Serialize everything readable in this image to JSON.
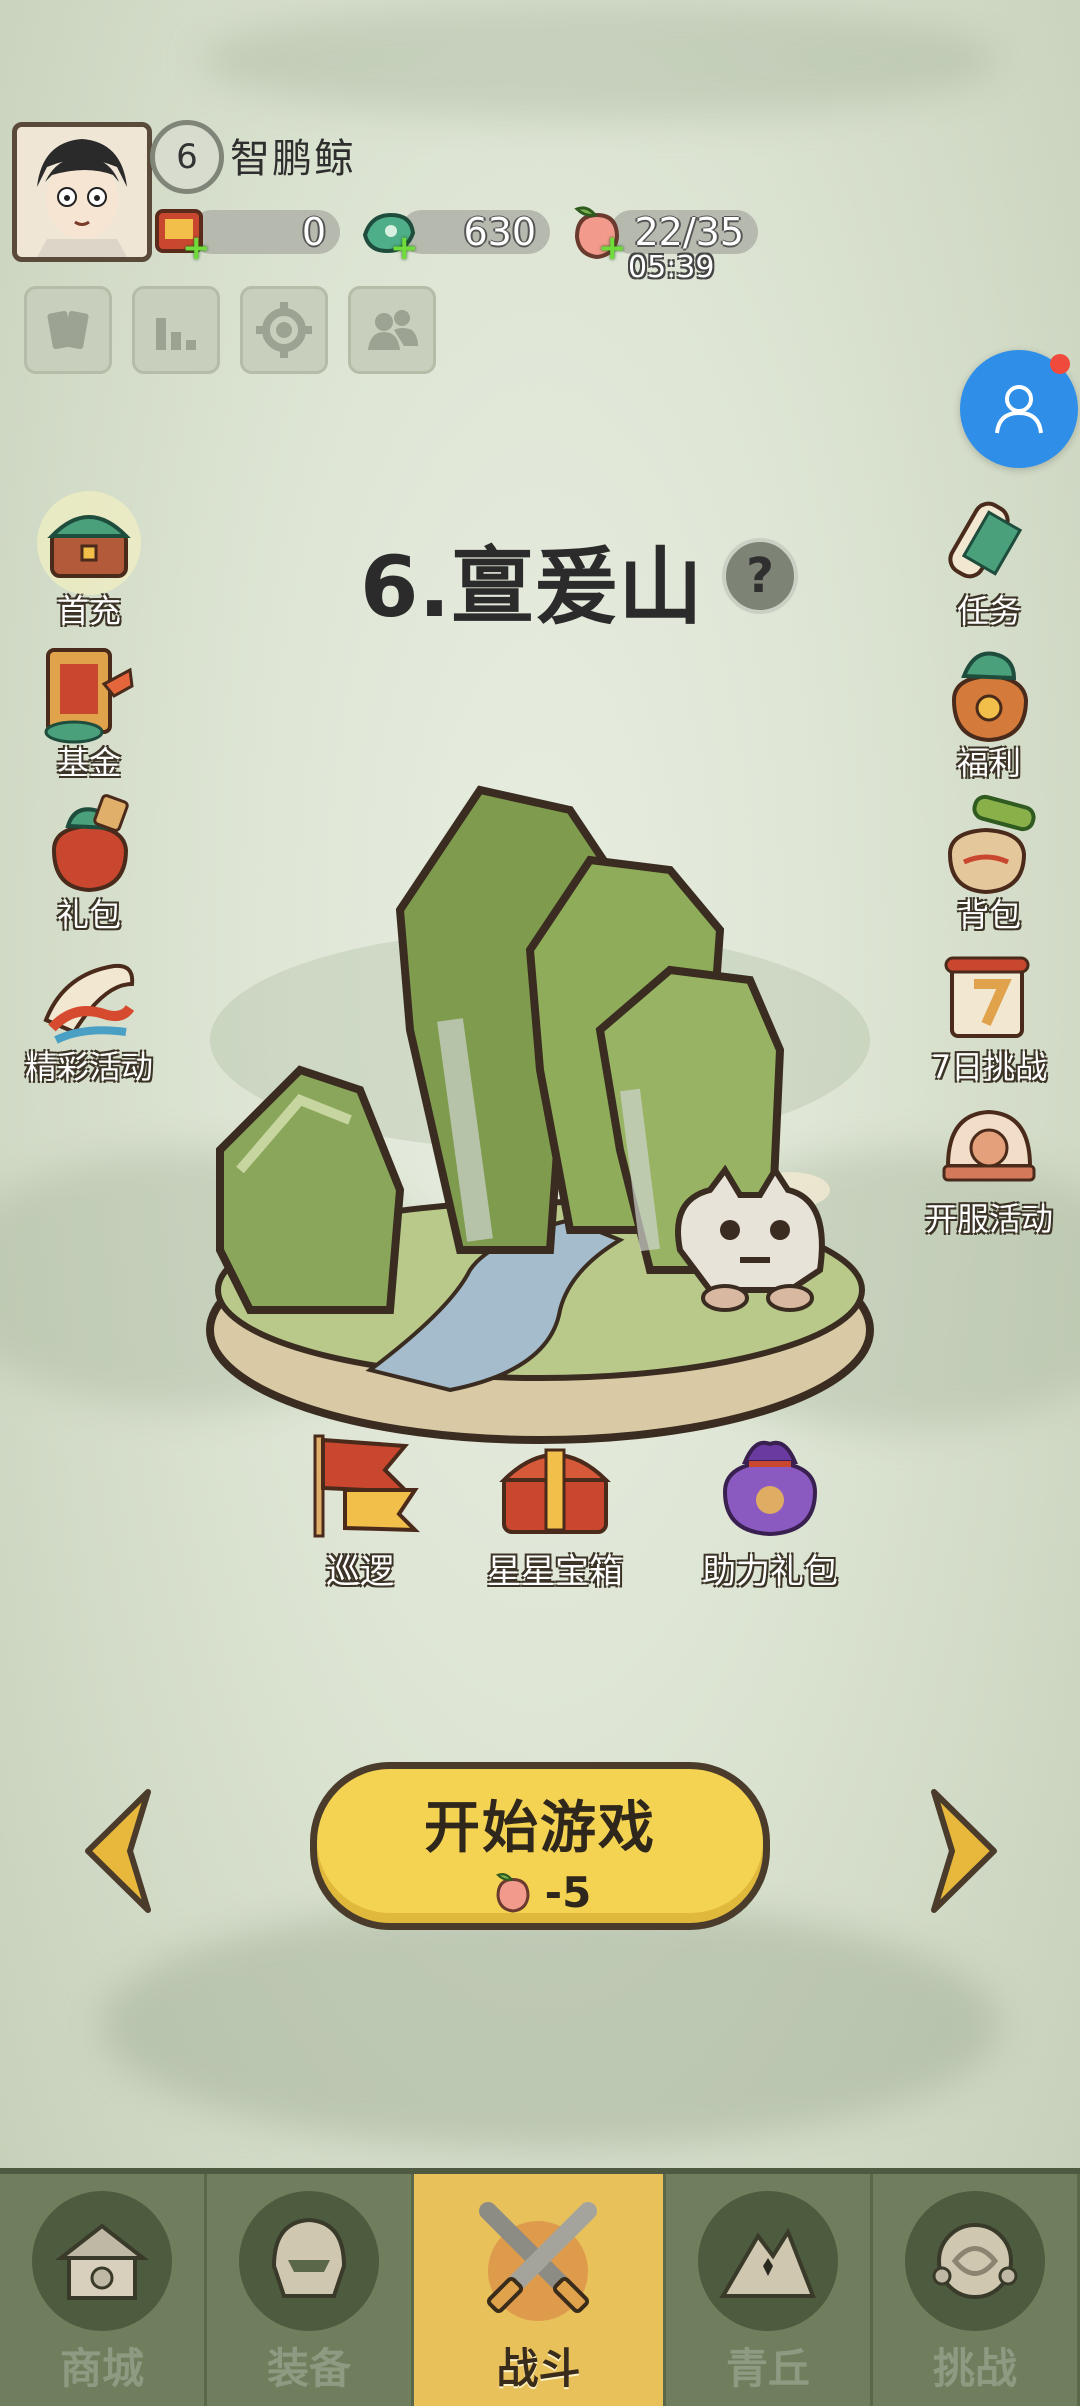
{
  "player": {
    "level": "6",
    "name": "智鹏鲸"
  },
  "resources": [
    {
      "id": "ticket",
      "value": "0"
    },
    {
      "id": "jade",
      "value": "630"
    },
    {
      "id": "stamina",
      "value": "22/35"
    }
  ],
  "stamina_timer": "05:39",
  "stage": {
    "title": "6.亶爰山",
    "help_symbol": "?"
  },
  "left_menu": [
    {
      "label": "首充"
    },
    {
      "label": "基金"
    },
    {
      "label": "礼包"
    },
    {
      "label": "精彩活动"
    }
  ],
  "right_menu": [
    {
      "label": "任务"
    },
    {
      "label": "福利"
    },
    {
      "label": "背包"
    },
    {
      "label": "7日挑战"
    },
    {
      "label": "开服活动"
    }
  ],
  "stage_rewards": [
    {
      "label": "巡逻"
    },
    {
      "label": "星星宝箱"
    },
    {
      "label": "助力礼包"
    }
  ],
  "start_button": {
    "label": "开始游戏",
    "cost": "-5"
  },
  "bottom_nav": [
    {
      "label": "商城",
      "active": false
    },
    {
      "label": "装备",
      "active": false
    },
    {
      "label": "战斗",
      "active": true
    },
    {
      "label": "青丘",
      "active": false
    },
    {
      "label": "挑战",
      "active": false
    }
  ],
  "colors": {
    "accent_yellow": "#f4d352",
    "nav_green": "#6f7e5d",
    "float_blue": "#2f8fe8",
    "notif_red": "#f04a3c"
  }
}
